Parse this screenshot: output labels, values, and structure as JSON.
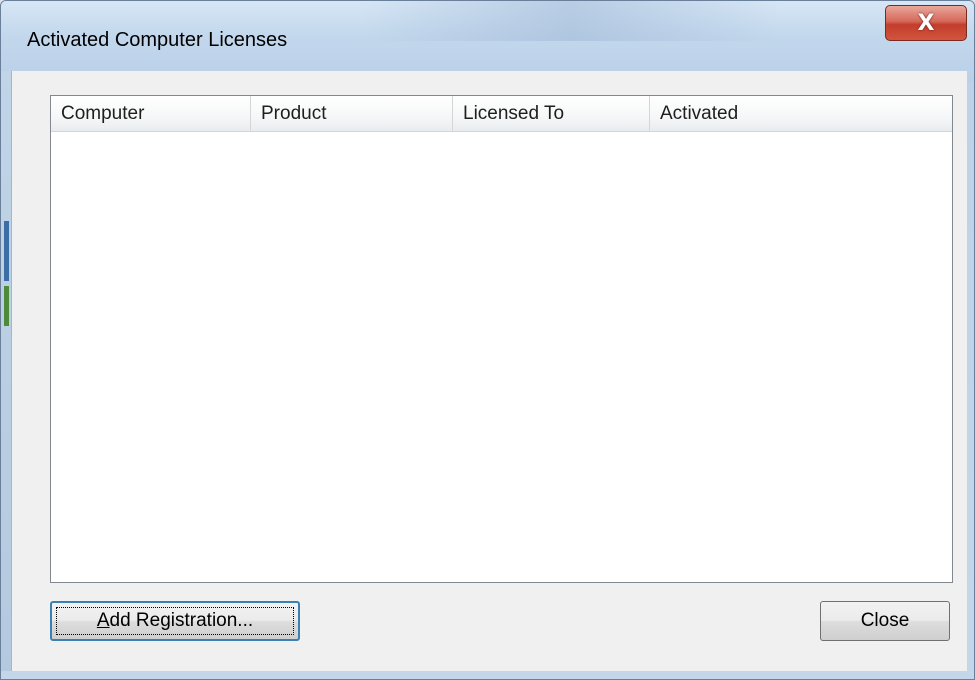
{
  "window": {
    "title": "Activated Computer Licenses",
    "close_glyph": "X"
  },
  "list": {
    "columns": [
      "Computer",
      "Product",
      "Licensed To",
      "Activated"
    ],
    "rows": []
  },
  "buttons": {
    "add_registration_accel": "A",
    "add_registration_rest": "dd Registration...",
    "close": "Close"
  },
  "colors": {
    "dialog_bg": "#f0f0f0",
    "title_close_red": "#c33d2b",
    "focus_border": "#3c7fb1"
  }
}
